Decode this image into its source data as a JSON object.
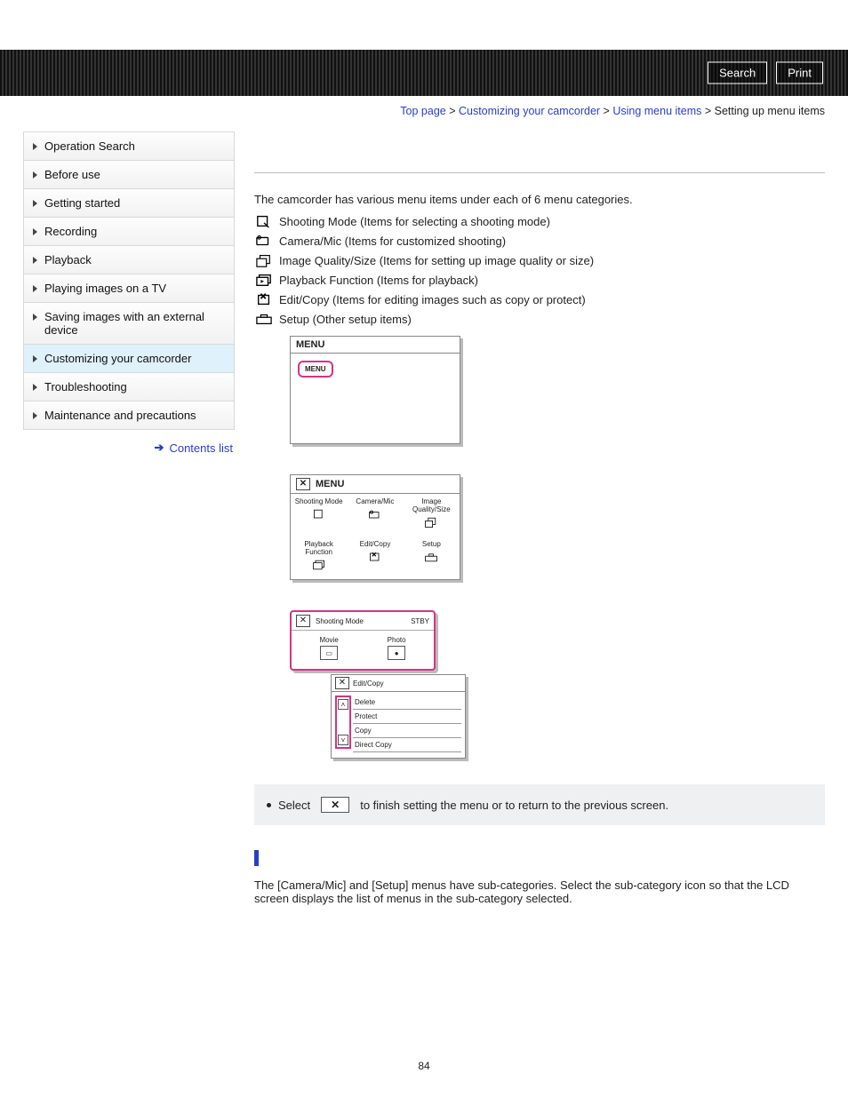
{
  "header": {
    "search": "Search",
    "print": "Print"
  },
  "breadcrumb": {
    "top": "Top page",
    "a": "Customizing your camcorder",
    "b": "Using menu items",
    "current": "Setting up menu items",
    "sep": " > "
  },
  "sidebar": {
    "items": [
      "Operation Search",
      "Before use",
      "Getting started",
      "Recording",
      "Playback",
      "Playing images on a TV",
      "Saving images with an external device",
      "Customizing your camcorder",
      "Troubleshooting",
      "Maintenance and precautions"
    ],
    "contents": "Contents list"
  },
  "content": {
    "intro": "The camcorder has various menu items under each of 6 menu categories.",
    "cats": [
      "Shooting Mode (Items for selecting a shooting mode)",
      "Camera/Mic (Items for customized shooting)",
      "Image Quality/Size (Items for setting up image quality or size)",
      "Playback Function (Items for playback)",
      "Edit/Copy (Items for editing images such as copy or protect)",
      "Setup (Other setup items)"
    ],
    "screen1": {
      "title": "MENU",
      "btn": "MENU"
    },
    "screen2": {
      "bar_x": "✕",
      "title": "MENU",
      "cells": [
        "Shooting Mode",
        "Camera/Mic",
        "Image Quality/Size",
        "Playback Function",
        "Edit/Copy",
        "Setup"
      ]
    },
    "screen3": {
      "bar_x": "✕",
      "title": "Shooting Mode",
      "status": "STBY",
      "movie": "Movie",
      "photo": "Photo",
      "sub_title": "Edit/Copy",
      "opts": [
        "Delete",
        "Protect",
        "Copy",
        "Direct Copy"
      ]
    },
    "note": {
      "pre": "Select",
      "x": "✕",
      "post": "to finish setting the menu or to return to the previous screen."
    },
    "notes_text": "The [Camera/Mic] and [Setup] menus have sub-categories. Select the sub-category icon so that the LCD screen displays the list of menus in the sub-category selected."
  },
  "page_number": "84"
}
